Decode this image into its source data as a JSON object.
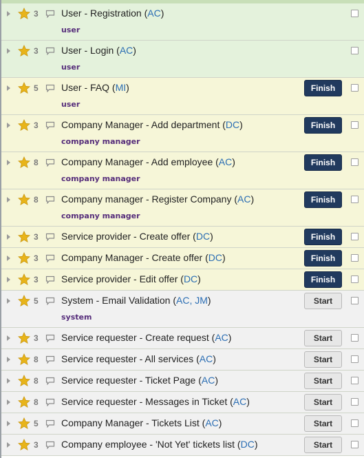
{
  "colors": {
    "ready_background": "#e4f2dc",
    "in_progress_background": "#f6f6d8",
    "todo_background": "#f1f1f1",
    "finish_button": "#213a5e",
    "start_button": "#e7e7e7",
    "initials": "#2a6db3",
    "tag": "#552c7a",
    "star": "#e8b41a"
  },
  "icons": {
    "expand": "triangle-right-icon",
    "points": "star-icon",
    "comments": "speech-bubble-icon",
    "select": "checkbox"
  },
  "stories": [
    {
      "points": "3",
      "title": "User - Registration",
      "initials": "AC",
      "tag": "user",
      "action": null,
      "state": "ready"
    },
    {
      "points": "3",
      "title": "User - Login",
      "initials": "AC",
      "tag": "user",
      "action": null,
      "state": "ready"
    },
    {
      "points": "5",
      "title": "User - FAQ",
      "initials": "MI",
      "tag": "user",
      "action": "Finish",
      "state": "in-progress"
    },
    {
      "points": "3",
      "title": "Company Manager - Add department",
      "initials": "DC",
      "tag": "company manager",
      "action": "Finish",
      "state": "in-progress"
    },
    {
      "points": "8",
      "title": "Company Manager - Add employee",
      "initials": "AC",
      "tag": "company manager",
      "action": "Finish",
      "state": "in-progress"
    },
    {
      "points": "8",
      "title": "Company manager - Register Company ",
      "initials": "AC",
      "tag": "company manager",
      "action": "Finish",
      "state": "in-progress"
    },
    {
      "points": "3",
      "title": "Service provider - Create offer",
      "initials": "DC",
      "tag": null,
      "action": "Finish",
      "state": "in-progress"
    },
    {
      "points": "3",
      "title": "Company Manager - Create offer",
      "initials": "DC",
      "tag": null,
      "action": "Finish",
      "state": "in-progress"
    },
    {
      "points": "3",
      "title": "Service provider - Edit offer",
      "initials": "DC",
      "tag": null,
      "action": "Finish",
      "state": "in-progress"
    },
    {
      "points": "5",
      "title": "System - Email Validation",
      "initials": "AC, JM",
      "tag": "system",
      "action": "Start",
      "state": "todo"
    },
    {
      "points": "3",
      "title": "Service requester - Create request",
      "initials": "AC",
      "tag": null,
      "action": "Start",
      "state": "todo"
    },
    {
      "points": "8",
      "title": "Service requester - All services",
      "initials": "AC",
      "tag": null,
      "action": "Start",
      "state": "todo"
    },
    {
      "points": "8",
      "title": "Service requester - Ticket Page",
      "initials": "AC",
      "tag": null,
      "action": "Start",
      "state": "todo"
    },
    {
      "points": "8",
      "title": "Service requester - Messages in Ticket",
      "initials": "AC",
      "tag": null,
      "action": "Start",
      "state": "todo"
    },
    {
      "points": "5",
      "title": "Company Manager - Tickets List",
      "initials": "AC",
      "tag": null,
      "action": "Start",
      "state": "todo"
    },
    {
      "points": "3",
      "title": "Company employee - 'Not Yet' tickets list",
      "initials": "DC",
      "tag": null,
      "action": "Start",
      "state": "todo"
    }
  ]
}
